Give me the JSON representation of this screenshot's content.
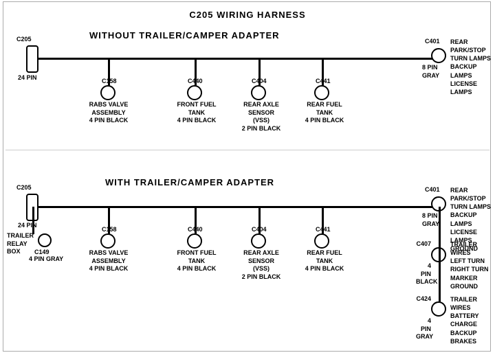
{
  "title": "C205 WIRING HARNESS",
  "section1": {
    "label": "WITHOUT  TRAILER/CAMPER ADAPTER",
    "left_connector": {
      "id": "C205",
      "pin": "24 PIN"
    },
    "right_connector": {
      "id": "C401",
      "pin": "8 PIN",
      "color": "GRAY"
    },
    "right_label": "REAR PARK/STOP\nTURN LAMPS\nBACKUP LAMPS\nLICENSE LAMPS",
    "connectors": [
      {
        "id": "C158",
        "desc": "RABS VALVE\nASSEMBLY\n4 PIN BLACK"
      },
      {
        "id": "C440",
        "desc": "FRONT FUEL\nTANK\n4 PIN BLACK"
      },
      {
        "id": "C404",
        "desc": "REAR AXLE\nSENSOR\n(VSS)\n2 PIN BLACK"
      },
      {
        "id": "C441",
        "desc": "REAR FUEL\nTANK\n4 PIN BLACK"
      }
    ]
  },
  "section2": {
    "label": "WITH TRAILER/CAMPER ADAPTER",
    "left_connector": {
      "id": "C205",
      "pin": "24 PIN"
    },
    "right_connector": {
      "id": "C401",
      "pin": "8 PIN",
      "color": "GRAY"
    },
    "right_label": "REAR PARK/STOP\nTURN LAMPS\nBACKUP LAMPS\nLICENSE LAMPS\nGROUND",
    "trailer_relay": "TRAILER\nRELAY\nBOX",
    "c149": {
      "id": "C149",
      "pin": "4 PIN GRAY"
    },
    "connectors": [
      {
        "id": "C158",
        "desc": "RABS VALVE\nASSEMBLY\n4 PIN BLACK"
      },
      {
        "id": "C440",
        "desc": "FRONT FUEL\nTANK\n4 PIN BLACK"
      },
      {
        "id": "C404",
        "desc": "REAR AXLE\nSENSOR\n(VSS)\n2 PIN BLACK"
      },
      {
        "id": "C441",
        "desc": "REAR FUEL\nTANK\n4 PIN BLACK"
      }
    ],
    "c407": {
      "id": "C407",
      "pin": "4 PIN",
      "color": "BLACK",
      "label": "TRAILER WIRES\nLEFT TURN\nRIGHT TURN\nMARKER\nGROUND"
    },
    "c424": {
      "id": "C424",
      "pin": "4 PIN",
      "color": "GRAY",
      "label": "TRAILER WIRES\nBATTERY CHARGE\nBACKUP\nBRAKES"
    }
  },
  "border": {
    "color": "#888"
  }
}
